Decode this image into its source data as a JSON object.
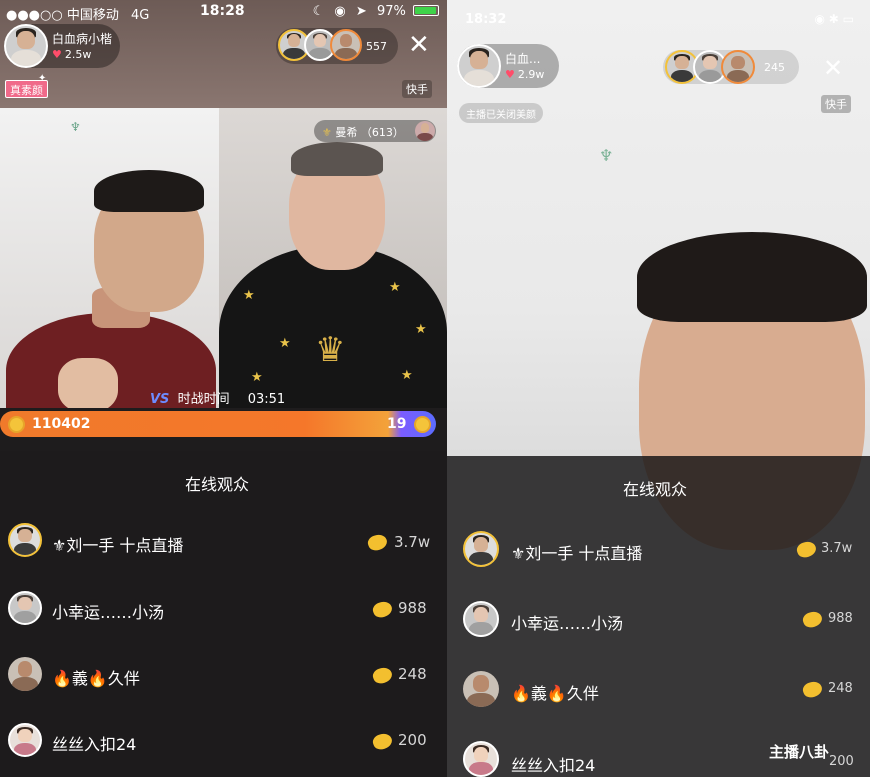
{
  "left": {
    "status": {
      "carrier": "●●●○○ 中国移动",
      "network": "4G",
      "time": "18:28",
      "battery": "97%"
    },
    "host": {
      "name": "白血病小楷",
      "likes": "2.5w",
      "tag": "真素颜"
    },
    "viewer_count": "557",
    "platform_tag": "快手",
    "guest": {
      "name": "曼希",
      "score": "（613）"
    },
    "pk": {
      "label": "时战时间",
      "timer": "03:51",
      "left_score": "110402",
      "right_score": "19",
      "left_fraction": 0.89
    },
    "sheet": {
      "title": "在线观众",
      "rows": [
        {
          "name": "⚜刘一手 十点直播",
          "value": "3.7w"
        },
        {
          "name": "小幸运……小汤",
          "value": "988"
        },
        {
          "name": "🔥義🔥久伴",
          "value": "248"
        },
        {
          "name": "丝丝入扣24",
          "value": "200"
        }
      ]
    }
  },
  "right": {
    "status": {
      "time": "18:32"
    },
    "host": {
      "name": "白血...",
      "likes": "2.9w"
    },
    "viewer_count": "245",
    "platform_tag": "快手",
    "notice": "主播已关闭美颜",
    "sheet": {
      "title": "在线观众",
      "rows": [
        {
          "name": "⚜刘一手 十点直播",
          "value": "3.7w"
        },
        {
          "name": "小幸运……小汤",
          "value": "988"
        },
        {
          "name": "🔥義🔥久伴",
          "value": "248"
        },
        {
          "name": "丝丝入扣24",
          "value": "200"
        }
      ]
    },
    "watermark": "主播八卦"
  },
  "colors": {
    "pk_orange": "#f5772a",
    "pk_blue": "#5b6cff",
    "heart": "#ff4d6a",
    "coin": "#f3bf2f"
  }
}
